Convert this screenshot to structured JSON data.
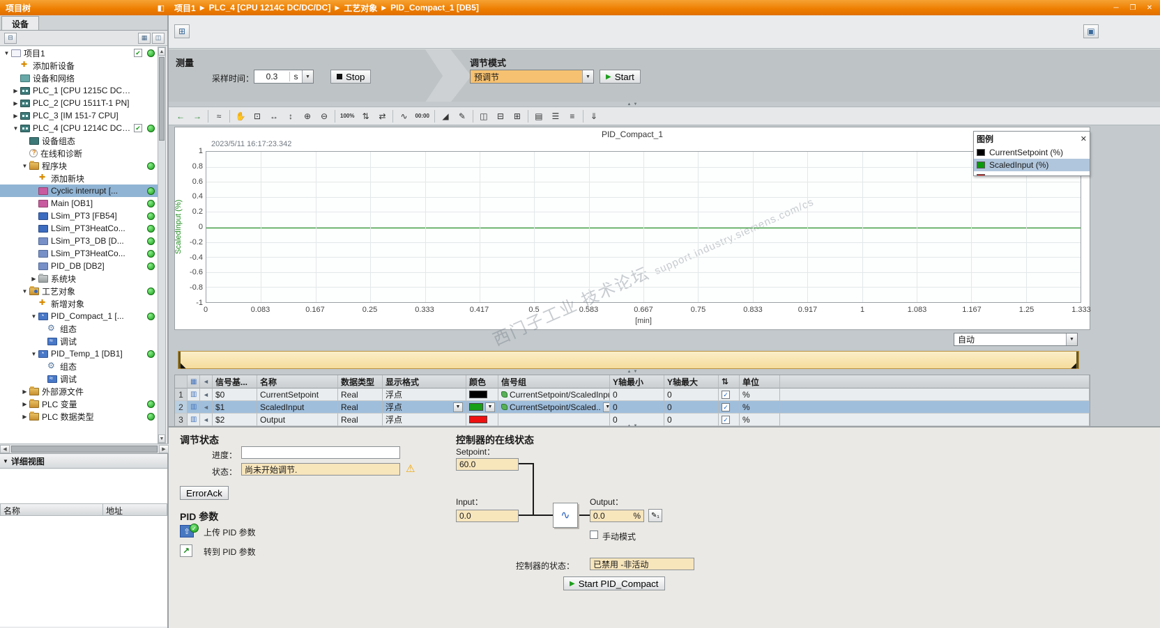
{
  "titlebar": {
    "project_tree_title": "项目树",
    "breadcrumb": [
      "项目1",
      "PLC_4 [CPU 1214C DC/DC/DC]",
      "工艺对象",
      "PID_Compact_1 [DB5]"
    ],
    "breadcrumb_separator": "▶"
  },
  "sidebar": {
    "devices_tab": "设备",
    "detail_view_title": "详细视图",
    "detail_columns": {
      "name": "名称",
      "address": "地址"
    },
    "tree": [
      {
        "label": "项目1",
        "level": 0,
        "icon": "project",
        "arrow": "open",
        "check": true,
        "dot": true
      },
      {
        "label": "添加新设备",
        "level": 1,
        "icon": "add-device",
        "arrow": "none"
      },
      {
        "label": "设备和网络",
        "level": 1,
        "icon": "network",
        "arrow": "none"
      },
      {
        "label": "PLC_1 [CPU 1215C DC/...",
        "level": 1,
        "icon": "plc",
        "arrow": "closed"
      },
      {
        "label": "PLC_2 [CPU 1511T-1 PN]",
        "level": 1,
        "icon": "plc",
        "arrow": "closed"
      },
      {
        "label": "PLC_3 [IM 151-7 CPU]",
        "level": 1,
        "icon": "plc",
        "arrow": "closed"
      },
      {
        "label": "PLC_4 [CPU 1214C DC/...",
        "level": 1,
        "icon": "plc",
        "arrow": "open",
        "check": true,
        "dot": true
      },
      {
        "label": "设备组态",
        "level": 2,
        "icon": "device-config",
        "arrow": "none"
      },
      {
        "label": "在线和诊断",
        "level": 2,
        "icon": "diagnostics",
        "arrow": "none"
      },
      {
        "label": "程序块",
        "level": 2,
        "icon": "folder",
        "arrow": "open",
        "dot": true
      },
      {
        "label": "添加新块",
        "level": 3,
        "icon": "add-block",
        "arrow": "none"
      },
      {
        "label": "Cyclic interrupt [...",
        "level": 3,
        "icon": "ob",
        "arrow": "none",
        "dot": true,
        "selected": true
      },
      {
        "label": "Main [OB1]",
        "level": 3,
        "icon": "ob",
        "arrow": "none",
        "dot": true
      },
      {
        "label": "LSim_PT3 [FB54]",
        "level": 3,
        "icon": "fb",
        "arrow": "none",
        "dot": true
      },
      {
        "label": "LSim_PT3HeatCo...",
        "level": 3,
        "icon": "fb",
        "arrow": "none",
        "dot": true
      },
      {
        "label": "LSim_PT3_DB [D...",
        "level": 3,
        "icon": "db",
        "arrow": "none",
        "dot": true
      },
      {
        "label": "LSim_PT3HeatCo...",
        "level": 3,
        "icon": "db",
        "arrow": "none",
        "dot": true
      },
      {
        "label": "PID_DB [DB2]",
        "level": 3,
        "icon": "db",
        "arrow": "none",
        "dot": true
      },
      {
        "label": "系统块",
        "level": 3,
        "icon": "folder-sys",
        "arrow": "closed"
      },
      {
        "label": "工艺对象",
        "level": 2,
        "icon": "folder-tech",
        "arrow": "open",
        "dot": true
      },
      {
        "label": "新增对象",
        "level": 3,
        "icon": "add-object",
        "arrow": "none"
      },
      {
        "label": "PID_Compact_1 [...",
        "level": 3,
        "icon": "tech",
        "arrow": "open",
        "dot": true
      },
      {
        "label": "组态",
        "level": 4,
        "icon": "config",
        "arrow": "none"
      },
      {
        "label": "调试",
        "level": 4,
        "icon": "commissioning",
        "arrow": "none"
      },
      {
        "label": "PID_Temp_1 [DB1]",
        "level": 3,
        "icon": "tech",
        "arrow": "open",
        "dot": true
      },
      {
        "label": "组态",
        "level": 4,
        "icon": "config",
        "arrow": "none"
      },
      {
        "label": "调试",
        "level": 4,
        "icon": "commissioning",
        "arrow": "none"
      },
      {
        "label": "外部源文件",
        "level": 2,
        "icon": "folder",
        "arrow": "closed"
      },
      {
        "label": "PLC 变量",
        "level": 2,
        "icon": "folder-tags",
        "arrow": "closed",
        "dot": true
      },
      {
        "label": "PLC 数据类型",
        "level": 2,
        "icon": "folder-types",
        "arrow": "closed",
        "dot": true
      }
    ]
  },
  "measurement": {
    "title": "测量",
    "sampling_label": "采样时间：",
    "sampling_value": "0.3",
    "sampling_unit": "s",
    "stop_label": "Stop"
  },
  "tuning_mode": {
    "title": "调节模式",
    "value": "预调节",
    "start_label": "Start"
  },
  "chart_toolbar": {
    "icons": [
      {
        "name": "previous-view-icon",
        "glyph": "←",
        "cls": "green"
      },
      {
        "name": "next-view-icon",
        "glyph": "→",
        "cls": "green"
      },
      {
        "name": "measure-cursor-icon",
        "glyph": "≈"
      },
      {
        "name": "pan-icon",
        "glyph": "✋",
        "cls": "hand"
      },
      {
        "name": "zoom-selection-icon",
        "glyph": "⊡"
      },
      {
        "name": "zoom-horizontal-icon",
        "glyph": "↔"
      },
      {
        "name": "zoom-vertical-icon",
        "glyph": "↕"
      },
      {
        "name": "zoom-in-icon",
        "glyph": "⊕"
      },
      {
        "name": "zoom-out-icon",
        "glyph": "⊖"
      },
      {
        "name": "zoom-100-icon",
        "glyph": "100%",
        "cls": "small-txt"
      },
      {
        "name": "fit-vertical-icon",
        "glyph": "⇅"
      },
      {
        "name": "fit-horizontal-icon",
        "glyph": "⇄"
      },
      {
        "name": "curve-overview-icon",
        "glyph": "∿"
      },
      {
        "name": "time-measurement-icon",
        "glyph": "00:00",
        "cls": "small-txt"
      },
      {
        "name": "trend-icon",
        "glyph": "◢"
      },
      {
        "name": "edit-icon",
        "glyph": "✎"
      },
      {
        "name": "vertical-split-icon",
        "glyph": "◫"
      },
      {
        "name": "horizontal-split-icon",
        "glyph": "⊟"
      },
      {
        "name": "table-zoom-icon",
        "glyph": "⊞"
      },
      {
        "name": "legend-icon",
        "glyph": "▤"
      },
      {
        "name": "align-left-icon",
        "glyph": "☰"
      },
      {
        "name": "align-right-icon",
        "glyph": "≡"
      },
      {
        "name": "export-icon",
        "glyph": "⇓"
      }
    ]
  },
  "chart": {
    "title": "PID_Compact_1",
    "timestamp": "2023/5/11 16:17:23.342",
    "y_axis_label": "ScaledInput (%)",
    "x_axis_label": "[min]",
    "y_ticks": [
      "1",
      "0.8",
      "0.6",
      "0.4",
      "0.2",
      "0",
      "-0.2",
      "-0.4",
      "-0.6",
      "-0.8",
      "-1"
    ],
    "x_ticks": [
      "0",
      "0.083",
      "0.167",
      "0.25",
      "0.333",
      "0.417",
      "0.5",
      "0.583",
      "0.667",
      "0.75",
      "0.833",
      "0.917",
      "1",
      "1.083",
      "1.167",
      "1.25",
      "1.333"
    ],
    "legend_title": "图例",
    "legend": [
      {
        "label": "CurrentSetpoint (%)",
        "color": "#000000"
      },
      {
        "label": "ScaledInput (%)",
        "color": "#0b9a0b",
        "selected": true
      },
      {
        "label": "",
        "color": "#ee1111"
      }
    ],
    "mode_select_value": "自动",
    "watermark_main": "西门子工业 技术论坛",
    "watermark_sub": "support.industry.siemens.com/cs",
    "zero_line_color": "#0b8a0b"
  },
  "signal_table": {
    "headers": {
      "base": "信号基...",
      "name": "名称",
      "type": "数据类型",
      "format": "显示格式",
      "color": "颜色",
      "group": "信号组",
      "ymin": "Y轴最小",
      "ymax": "Y轴最大",
      "unit": "单位"
    },
    "rows": [
      {
        "num": "1",
        "base": "$0",
        "name": "CurrentSetpoint",
        "type": "Real",
        "format": "浮点",
        "color": "#000000",
        "group": "CurrentSetpoint/ScaledInpu",
        "ymin": "0",
        "ymax": "0",
        "auto": true,
        "unit": "%"
      },
      {
        "num": "2",
        "base": "$1",
        "name": "ScaledInput",
        "type": "Real",
        "format": "浮点",
        "color": "#18a018",
        "group": "CurrentSetpoint/Scaled..",
        "ymin": "0",
        "ymax": "0",
        "auto": true,
        "unit": "%",
        "selected": true
      },
      {
        "num": "3",
        "base": "$2",
        "name": "Output",
        "type": "Real",
        "format": "浮点",
        "color": "#ee1111",
        "group": "",
        "ymin": "0",
        "ymax": "0",
        "auto": true,
        "unit": "%"
      }
    ]
  },
  "tuning_status": {
    "title": "调节状态",
    "progress_label": "进度：",
    "progress_value": "",
    "state_label": "状态：",
    "state_value": "尚未开始调节.",
    "error_ack_label": "ErrorAck"
  },
  "pid_params": {
    "title": "PID 参数",
    "upload_label": "上传 PID 参数",
    "goto_label": "转到 PID 参数"
  },
  "controller_status": {
    "title": "控制器的在线状态",
    "setpoint_label": "Setpoint：",
    "setpoint_value": "60.0",
    "input_label": "Input：",
    "input_value": "0.0",
    "output_label": "Output：",
    "output_value": "0.0",
    "output_unit": "%",
    "manual_mode_label": "手动模式",
    "state_label": "控制器的状态：",
    "state_value": "已禁用 -非活动",
    "start_button_label": "Start PID_Compact"
  }
}
